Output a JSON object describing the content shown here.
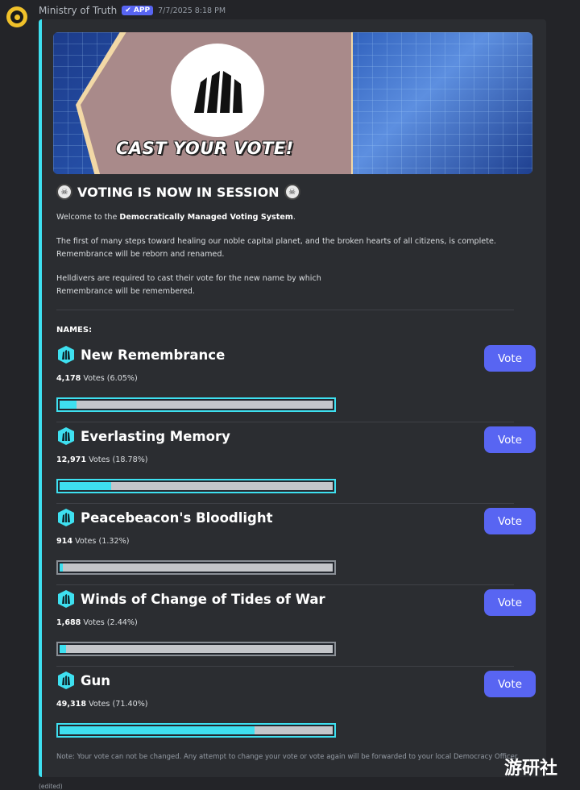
{
  "message": {
    "author": "Ministry of Truth",
    "badge": "✔ APP",
    "timestamp": "7/7/2025 8:18 PM",
    "edited": "(edited)"
  },
  "embed": {
    "accent_color": "#3ee0f0",
    "banner_text": "CAST YOUR VOTE!",
    "session_title": "VOTING IS NOW IN SESSION",
    "welcome_prefix": "Welcome to the ",
    "welcome_bold": "Democratically Managed Voting System",
    "welcome_suffix": ".",
    "paragraph1_line1": "The first of many steps toward healing our noble capital planet, and the broken hearts of all citizens, is complete.",
    "paragraph1_line2": "Remembrance will be reborn and renamed.",
    "paragraph2_line1": "Helldivers are required to cast their vote for the new name by which",
    "paragraph2_line2": "Remembrance will be remembered.",
    "names_label": "NAMES:",
    "note": "Note: Your vote can not be changed. Any attempt to change your vote or vote again will be forwarded to your local Democracy Officer."
  },
  "options": [
    {
      "name": "New Remembrance",
      "votes": "4,178",
      "votes_suffix": " Votes (6.05%)",
      "percent": 6.05,
      "button": "Vote"
    },
    {
      "name": "Everlasting Memory",
      "votes": "12,971",
      "votes_suffix": " Votes (18.78%)",
      "percent": 18.78,
      "button": "Vote"
    },
    {
      "name": "Peacebeacon's Bloodlight",
      "votes": "914",
      "votes_suffix": " Votes (1.32%)",
      "percent": 1.32,
      "button": "Vote"
    },
    {
      "name": "Winds of Change of Tides of War",
      "votes": "1,688",
      "votes_suffix": " Votes (2.44%)",
      "percent": 2.44,
      "button": "Vote"
    },
    {
      "name": "Gun",
      "votes": "49,318",
      "votes_suffix": " Votes (71.40%)",
      "percent": 71.4,
      "button": "Vote"
    }
  ],
  "watermark": "游研社",
  "colors": {
    "bar_fill": "#3ee0f0",
    "button": "#5865f2",
    "background": "#232428"
  }
}
